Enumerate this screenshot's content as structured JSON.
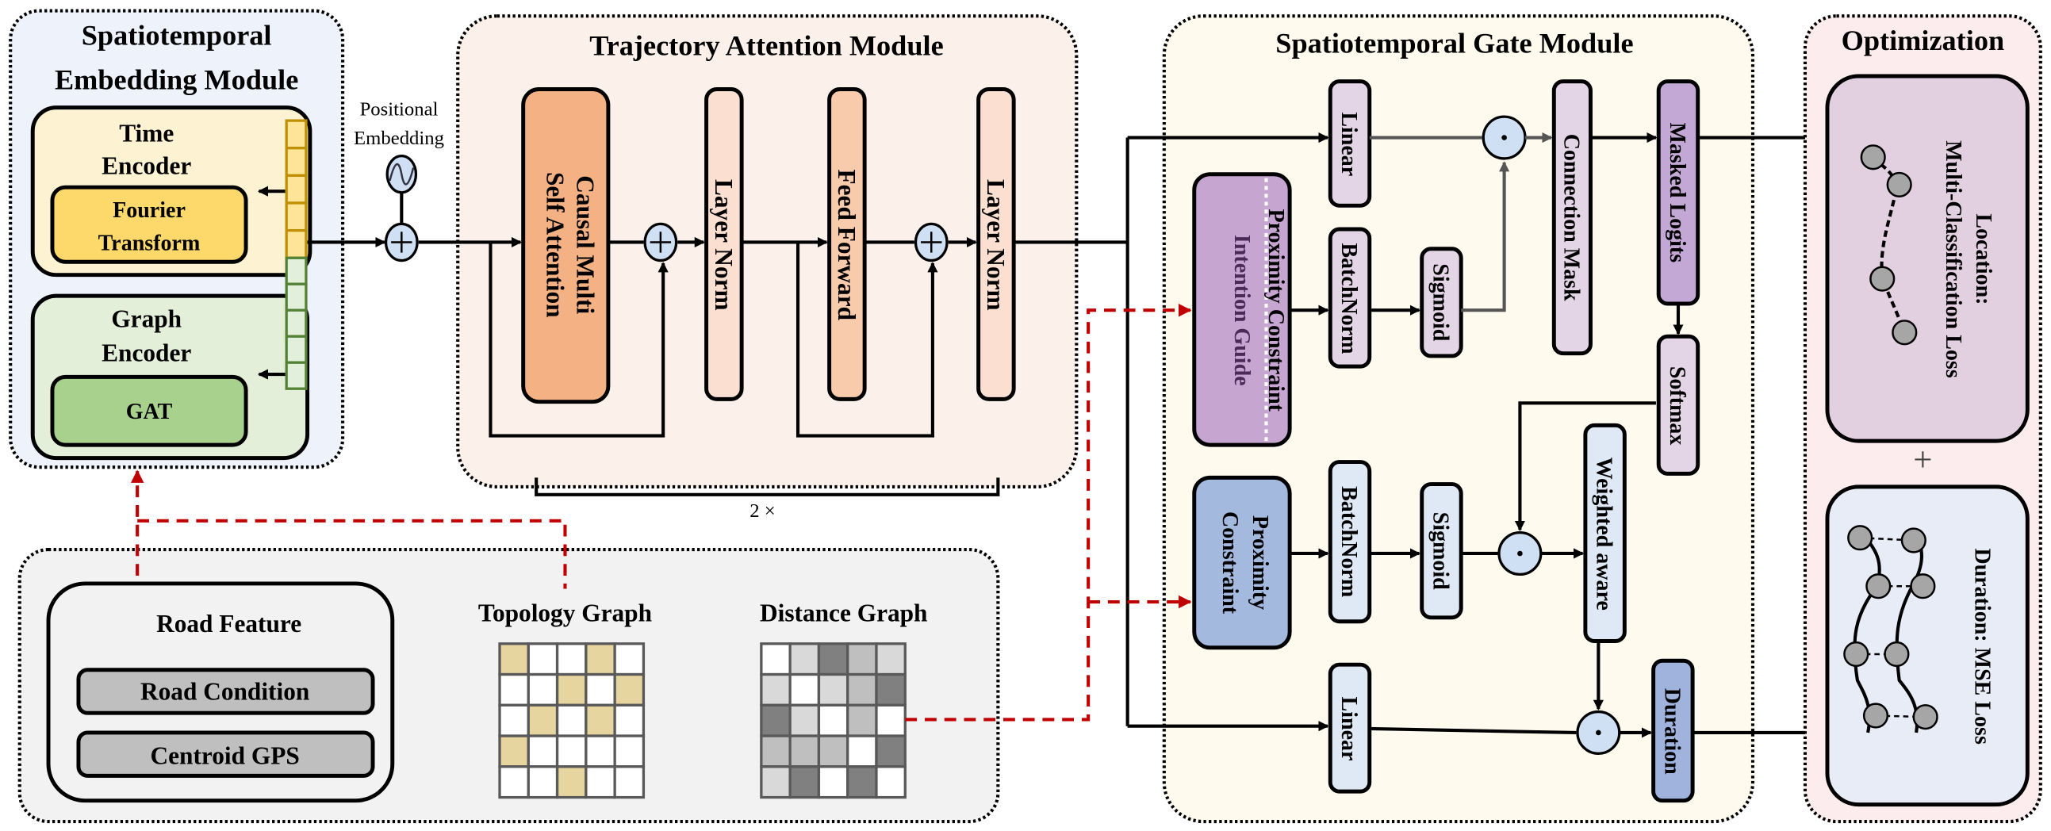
{
  "embedding_module": {
    "title_line1": "Spatiotemporal",
    "title_line2": "Embedding Module",
    "time_encoder": {
      "line1": "Time",
      "line2": "Encoder",
      "inner_line1": "Fourier",
      "inner_line2": "Transform"
    },
    "graph_encoder": {
      "line1": "Graph",
      "line2": "Encoder",
      "inner": "GAT"
    },
    "positional_embedding": {
      "line1": "Positional",
      "line2": "Embedding"
    }
  },
  "attention_module": {
    "title": "Trajectory Attention Module",
    "causal_line1": "Causal Multi",
    "causal_line2": "Self Attention",
    "layer_norm_1": "Layer Norm",
    "feed_forward": "Feed Forward",
    "layer_norm_2": "Layer Norm",
    "repeat": "2 ×"
  },
  "gate_module": {
    "title": "Spatiotemporal Gate Module",
    "linear_top": "Linear",
    "intention_line1": "Proximity Constraint",
    "intention_line2": "Intention Guide",
    "batchnorm_top": "BatchNorm",
    "sigmoid_top": "Sigmoid",
    "connection_mask": "Connection Mask",
    "masked_logits": "Masked Logits",
    "softmax": "Softmax",
    "proximity_line1": "Proximity",
    "proximity_line2": "Constraint",
    "batchnorm_bottom": "BatchNorm",
    "sigmoid_bottom": "Sigmoid",
    "weighted_aware": "Weighted aware",
    "linear_bottom": "Linear",
    "duration": "Duration"
  },
  "optimization": {
    "title": "Optimization",
    "location_line1": "Location:",
    "location_line2": "Multi-Classification Loss",
    "plus": "+",
    "duration_loss": "Duration: MSE Loss"
  },
  "inputs": {
    "road_feature": "Road Feature",
    "road_condition": "Road Condition",
    "centroid_gps": "Centroid GPS",
    "topology_graph": "Topology Graph",
    "distance_graph": "Distance Graph",
    "topology_matrix": [
      [
        1,
        0,
        0,
        1,
        0
      ],
      [
        0,
        0,
        1,
        0,
        1
      ],
      [
        0,
        1,
        0,
        1,
        0
      ],
      [
        1,
        0,
        0,
        0,
        0
      ],
      [
        0,
        0,
        1,
        0,
        0
      ]
    ],
    "distance_matrix": [
      [
        0,
        1,
        3,
        2,
        1
      ],
      [
        1,
        0,
        1,
        2,
        3
      ],
      [
        3,
        1,
        0,
        2,
        0
      ],
      [
        2,
        2,
        2,
        0,
        3
      ],
      [
        1,
        3,
        0,
        3,
        0
      ]
    ]
  },
  "colors": {
    "topology_on": "#e6d59f",
    "distance_levels": [
      "#ffffff",
      "#d9d9d9",
      "#bfbfbf",
      "#808080"
    ],
    "dashed_flow": "#c00000"
  }
}
